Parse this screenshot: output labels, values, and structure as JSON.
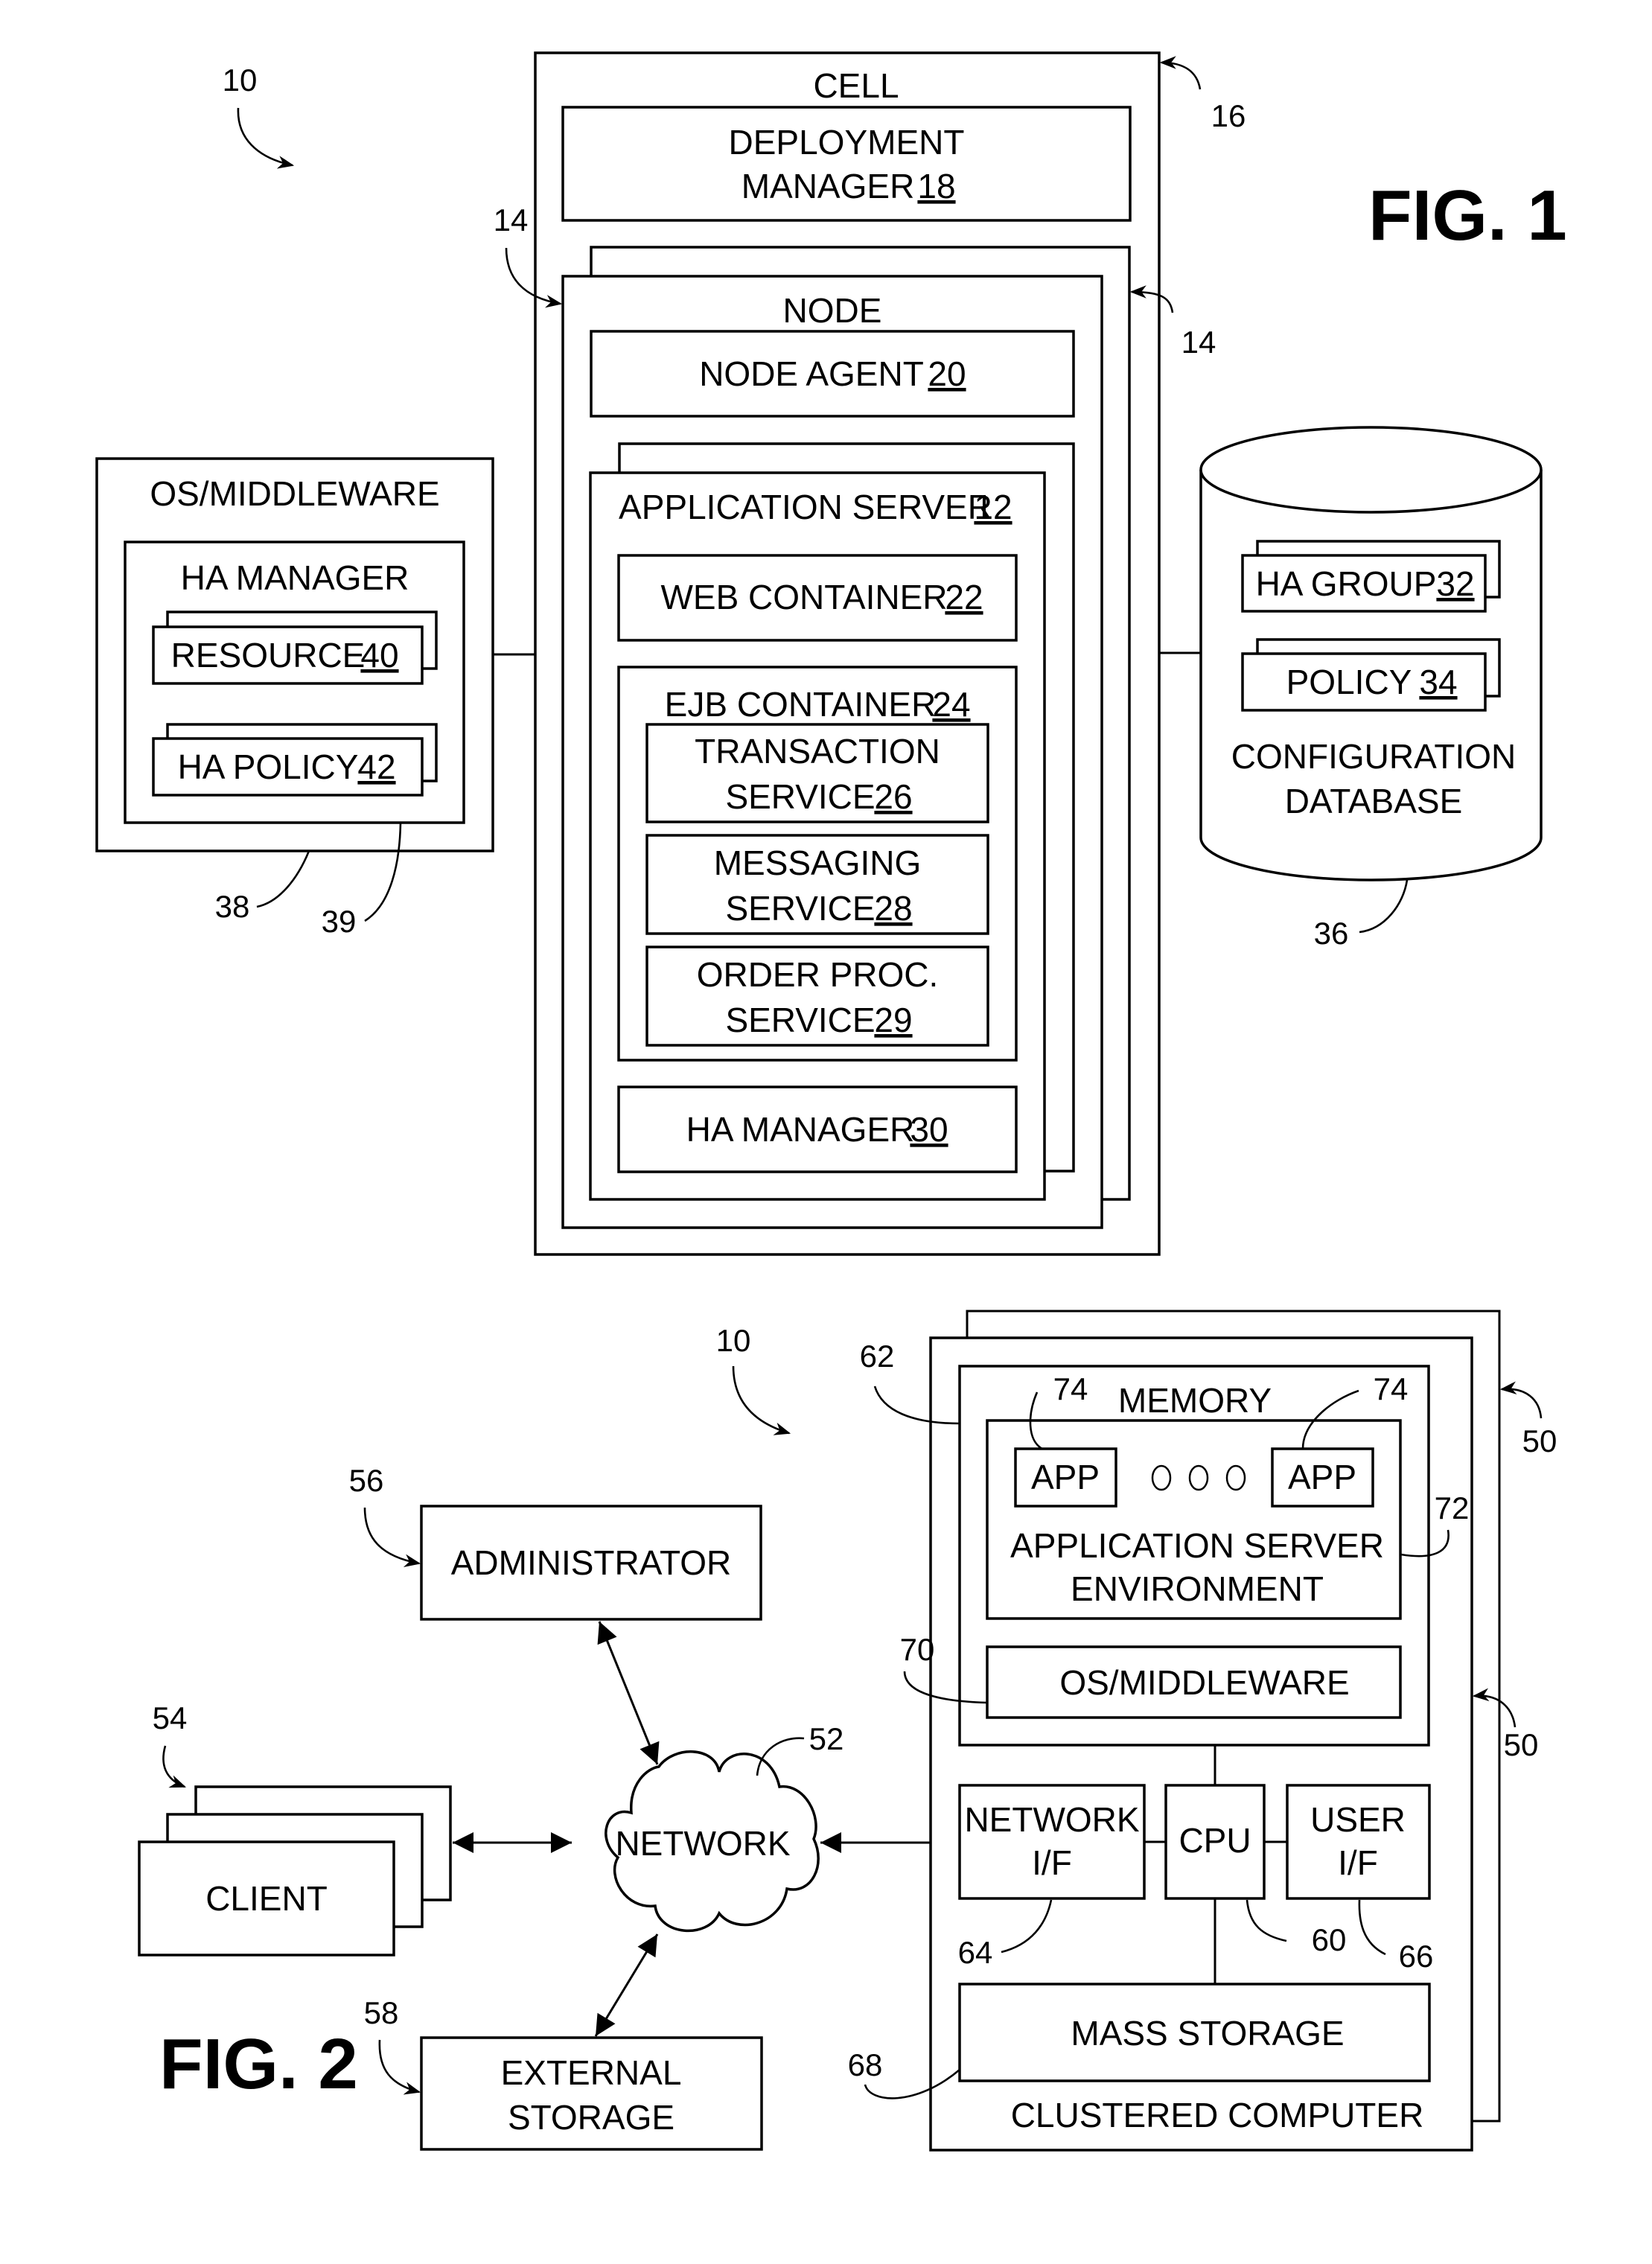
{
  "fig1": {
    "title": "FIG. 1",
    "system_ref": "10",
    "cell": {
      "label": "CELL",
      "ref": "16"
    },
    "deployment_manager": {
      "label": "DEPLOYMENT",
      "label2": "MANAGER",
      "ref": "18"
    },
    "node": {
      "label": "NODE",
      "ref_left": "14",
      "ref_right": "14"
    },
    "node_agent": {
      "label": "NODE AGENT",
      "ref": "20"
    },
    "application_server": {
      "label": "APPLICATION SERVER",
      "ref": "12"
    },
    "web_container": {
      "label": "WEB CONTAINER",
      "ref": "22"
    },
    "ejb_container": {
      "label": "EJB CONTAINER",
      "ref": "24"
    },
    "transaction_service": {
      "label": "TRANSACTION",
      "label2": "SERVICE",
      "ref": "26"
    },
    "messaging_service": {
      "label": "MESSAGING",
      "label2": "SERVICE",
      "ref": "28"
    },
    "order_proc_service": {
      "label": "ORDER PROC.",
      "label2": "SERVICE",
      "ref": "29"
    },
    "ha_manager_server": {
      "label": "HA MANAGER",
      "ref": "30"
    },
    "os_middleware": {
      "label": "OS/MIDDLEWARE",
      "ref": "38"
    },
    "ha_manager_os": {
      "label": "HA MANAGER",
      "ref": "39"
    },
    "resource": {
      "label": "RESOURCE",
      "ref": "40"
    },
    "ha_policy": {
      "label": "HA POLICY",
      "ref": "42"
    },
    "config_db": {
      "label": "CONFIGURATION",
      "label2": "DATABASE",
      "ref": "36"
    },
    "ha_group": {
      "label": "HA GROUP",
      "ref": "32"
    },
    "policy": {
      "label": "POLICY",
      "ref": "34"
    }
  },
  "fig2": {
    "title": "FIG. 2",
    "system_ref": "10",
    "administrator": {
      "label": "ADMINISTRATOR",
      "ref": "56"
    },
    "client": {
      "label": "CLIENT",
      "ref": "54"
    },
    "network": {
      "label": "NETWORK",
      "ref": "52"
    },
    "external_storage": {
      "label": "EXTERNAL",
      "label2": "STORAGE",
      "ref": "58"
    },
    "clustered_computer": {
      "label": "CLUSTERED COMPUTER",
      "ref_top": "50",
      "ref_bottom": "50"
    },
    "memory": {
      "label": "MEMORY",
      "ref": "62"
    },
    "app_left": {
      "label": "APP",
      "ref": "74"
    },
    "app_right": {
      "label": "APP",
      "ref": "74"
    },
    "app_server_env": {
      "label": "APPLICATION SERVER",
      "label2": "ENVIRONMENT",
      "ref": "72"
    },
    "os_middleware": {
      "label": "OS/MIDDLEWARE",
      "ref": "70"
    },
    "network_if": {
      "label": "NETWORK",
      "label2": "I/F",
      "ref": "64"
    },
    "cpu": {
      "label": "CPU",
      "ref": "60"
    },
    "user_if": {
      "label": "USER",
      "label2": "I/F",
      "ref": "66"
    },
    "mass_storage": {
      "label": "MASS STORAGE",
      "ref": "68"
    }
  }
}
